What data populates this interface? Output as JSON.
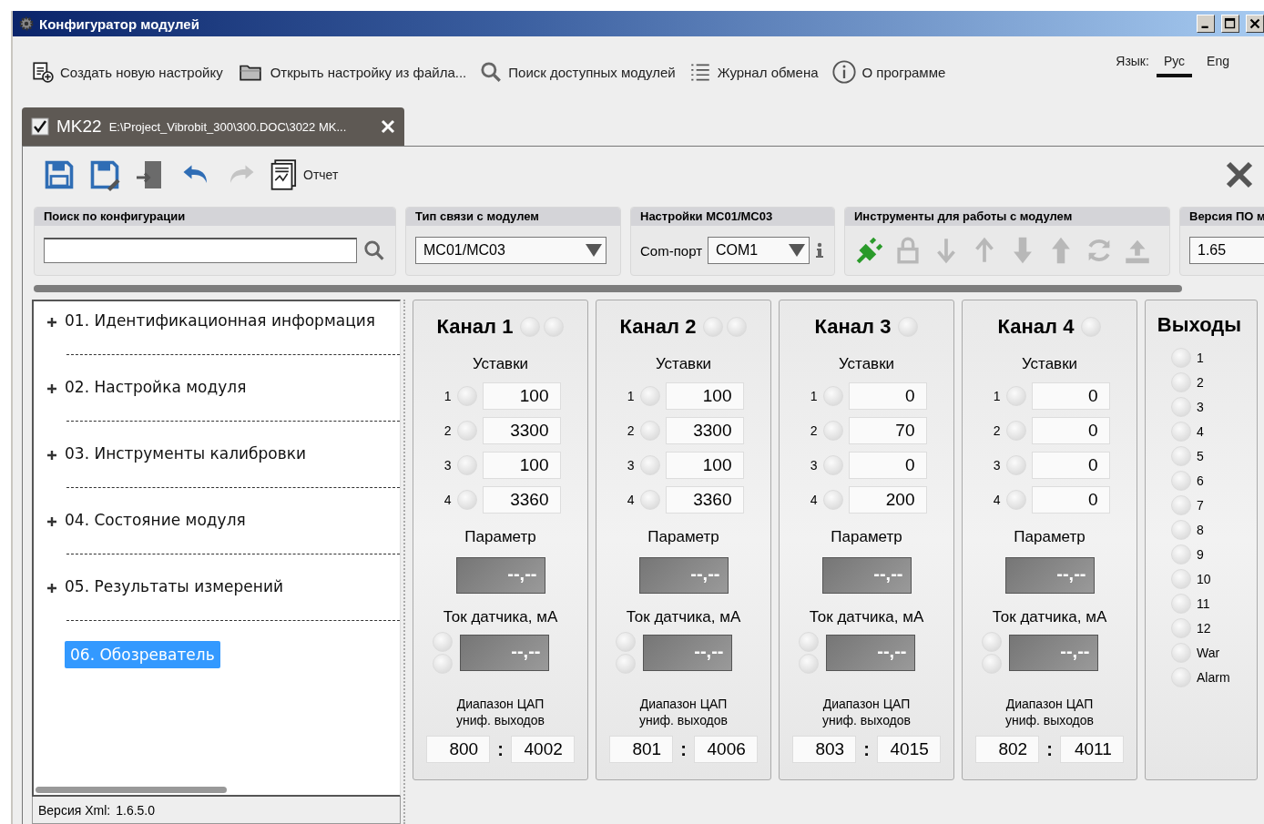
{
  "window": {
    "title": "Конфигуратор модулей"
  },
  "toolbar": [
    {
      "kind": "new",
      "label": "Создать новую настройку"
    },
    {
      "kind": "open",
      "label": "Открыть настройку из файла..."
    },
    {
      "kind": "search",
      "label": "Поиск доступных модулей"
    },
    {
      "kind": "log",
      "label": "Журнал обмена"
    },
    {
      "kind": "about",
      "label": "О программе"
    }
  ],
  "language": {
    "label": "Язык:",
    "options": [
      {
        "label": "Рус",
        "selected": true
      },
      {
        "label": "Eng",
        "selected": false
      }
    ]
  },
  "tab": {
    "checked": true,
    "label": "MK22",
    "path": "E:\\Project_Vibrobit_300\\300.DOC\\3022 MK..."
  },
  "doc_toolbar": {
    "buttons": [
      {
        "kind": "save",
        "disabled": false
      },
      {
        "kind": "save-as",
        "disabled": false
      },
      {
        "kind": "export",
        "disabled": false
      },
      {
        "kind": "undo",
        "disabled": false
      },
      {
        "kind": "redo",
        "disabled": true
      }
    ],
    "report_label": "Отчет"
  },
  "search_group": {
    "title": "Поиск по конфигурации"
  },
  "link_group": {
    "title": "Тип связи с модулем",
    "value": "MC01/MC03"
  },
  "mc_group": {
    "title": "Настройки MC01/MC03",
    "port_label": "Com-порт",
    "port_value": "COM1"
  },
  "tools_group": {
    "title": "Инструменты для работы с модулем",
    "tools": [
      {
        "kind": "connect",
        "disabled": false
      },
      {
        "kind": "lock",
        "disabled": true
      },
      {
        "kind": "down",
        "disabled": true
      },
      {
        "kind": "up",
        "disabled": true
      },
      {
        "kind": "down-bold",
        "disabled": true
      },
      {
        "kind": "up-bold",
        "disabled": true
      },
      {
        "kind": "refresh",
        "disabled": true
      },
      {
        "kind": "upload",
        "disabled": true
      }
    ]
  },
  "version_group": {
    "title": "Версия ПО м",
    "value": "1.65"
  },
  "tree": [
    {
      "label": "01. Идентификационная информация",
      "expandable": true,
      "selected": false
    },
    {
      "label": "02. Настройка модуля",
      "expandable": true,
      "selected": false
    },
    {
      "label": "03. Инструменты калибровки",
      "expandable": true,
      "selected": false
    },
    {
      "label": "04. Состояние модуля",
      "expandable": true,
      "selected": false
    },
    {
      "label": "05. Результаты измерений",
      "expandable": true,
      "selected": false
    },
    {
      "label": "06. Обозреватель",
      "expandable": false,
      "selected": true
    }
  ],
  "status": {
    "label": "Версия Xml:",
    "value": "1.6.5.0"
  },
  "channels": [
    {
      "title": "Канал 1",
      "leds": [
        {
          "on": false
        },
        {
          "on": false
        }
      ],
      "setpoints_title": "Уставки",
      "setpoints": [
        {
          "index": "1",
          "on": false,
          "value": "100"
        },
        {
          "index": "2",
          "on": false,
          "value": "3300"
        },
        {
          "index": "3",
          "on": false,
          "value": "100"
        },
        {
          "index": "4",
          "on": false,
          "value": "3360"
        }
      ],
      "param_title": "Параметр",
      "param_value": "--,--",
      "current_title": "Ток датчика, мА",
      "current_leds": [
        {
          "on": false
        },
        {
          "on": false
        }
      ],
      "current_value": "--,--",
      "dac_title": "Диапазон ЦАП\nуниф. выходов",
      "dac_min": "800",
      "dac_sep": ":",
      "dac_max": "4002"
    },
    {
      "title": "Канал 2",
      "leds": [
        {
          "on": false
        },
        {
          "on": false
        }
      ],
      "setpoints_title": "Уставки",
      "setpoints": [
        {
          "index": "1",
          "on": false,
          "value": "100"
        },
        {
          "index": "2",
          "on": false,
          "value": "3300"
        },
        {
          "index": "3",
          "on": false,
          "value": "100"
        },
        {
          "index": "4",
          "on": false,
          "value": "3360"
        }
      ],
      "param_title": "Параметр",
      "param_value": "--,--",
      "current_title": "Ток датчика, мА",
      "current_leds": [
        {
          "on": false
        },
        {
          "on": false
        }
      ],
      "current_value": "--,--",
      "dac_title": "Диапазон ЦАП\nуниф. выходов",
      "dac_min": "801",
      "dac_sep": ":",
      "dac_max": "4006"
    },
    {
      "title": "Канал 3",
      "leds": [
        {
          "on": false
        }
      ],
      "setpoints_title": "Уставки",
      "setpoints": [
        {
          "index": "1",
          "on": false,
          "value": "0"
        },
        {
          "index": "2",
          "on": false,
          "value": "70"
        },
        {
          "index": "3",
          "on": false,
          "value": "0"
        },
        {
          "index": "4",
          "on": false,
          "value": "200"
        }
      ],
      "param_title": "Параметр",
      "param_value": "--,--",
      "current_title": "Ток датчика, мА",
      "current_leds": [
        {
          "on": false
        },
        {
          "on": false
        }
      ],
      "current_value": "--,--",
      "dac_title": "Диапазон ЦАП\nуниф. выходов",
      "dac_min": "803",
      "dac_sep": ":",
      "dac_max": "4015"
    },
    {
      "title": "Канал 4",
      "leds": [
        {
          "on": false
        }
      ],
      "setpoints_title": "Уставки",
      "setpoints": [
        {
          "index": "1",
          "on": false,
          "value": "0"
        },
        {
          "index": "2",
          "on": false,
          "value": "0"
        },
        {
          "index": "3",
          "on": false,
          "value": "0"
        },
        {
          "index": "4",
          "on": false,
          "value": "0"
        }
      ],
      "param_title": "Параметр",
      "param_value": "--,--",
      "current_title": "Ток датчика, мА",
      "current_leds": [
        {
          "on": false
        },
        {
          "on": false
        }
      ],
      "current_value": "--,--",
      "dac_title": "Диапазон ЦАП\nуниф. выходов",
      "dac_min": "802",
      "dac_sep": ":",
      "dac_max": "4011"
    }
  ],
  "outputs": {
    "title": "Выходы",
    "items": [
      {
        "label": "1",
        "on": false
      },
      {
        "label": "2",
        "on": false
      },
      {
        "label": "3",
        "on": false
      },
      {
        "label": "4",
        "on": false
      },
      {
        "label": "5",
        "on": false
      },
      {
        "label": "6",
        "on": false
      },
      {
        "label": "7",
        "on": false
      },
      {
        "label": "8",
        "on": false
      },
      {
        "label": "9",
        "on": false
      },
      {
        "label": "10",
        "on": false
      },
      {
        "label": "11",
        "on": false
      },
      {
        "label": "12",
        "on": false
      },
      {
        "label": "War",
        "on": false
      },
      {
        "label": "Alarm",
        "on": false
      }
    ]
  }
}
